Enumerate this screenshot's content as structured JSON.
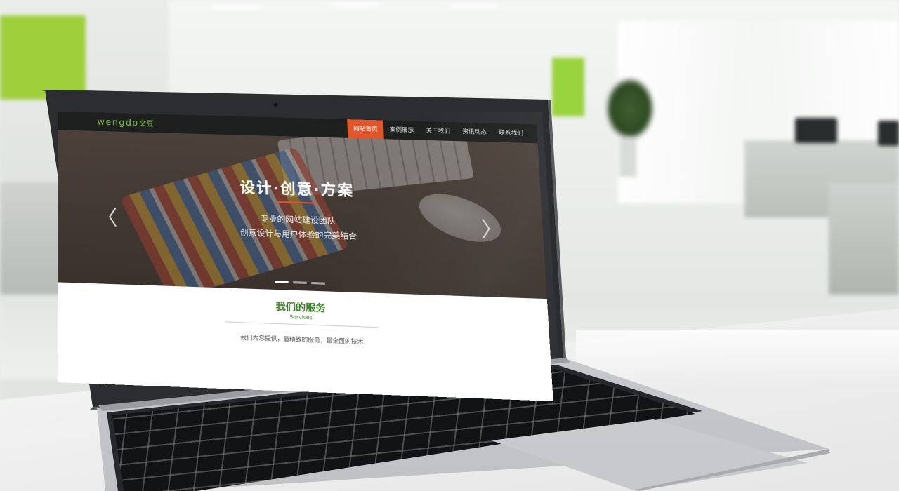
{
  "site": {
    "logo_latin": "wengdo",
    "logo_cn": "文豆"
  },
  "nav": {
    "items": [
      {
        "label": "网站首页",
        "active": true
      },
      {
        "label": "案例展示",
        "active": false
      },
      {
        "label": "关于我们",
        "active": false
      },
      {
        "label": "资讯动态",
        "active": false
      },
      {
        "label": "联系我们",
        "active": false
      }
    ]
  },
  "banner": {
    "title": "设计·创意·方案",
    "subtitle_line1": "专业的网站建设团队",
    "subtitle_line2": "创意设计与用户体验的完美结合",
    "prev_glyph": "〈",
    "next_glyph": "〉",
    "slide_count": 3,
    "active_slide": 1
  },
  "services": {
    "title": "我们的服务",
    "title_en": "Services",
    "description": "我们为您提供，最精致的服务，最全面的技术"
  },
  "colors": {
    "accent": "#e0562a",
    "brand_green": "#3f7f2a",
    "logo_green": "#7fbf3f",
    "nav_bg": "#1e1f1f"
  }
}
